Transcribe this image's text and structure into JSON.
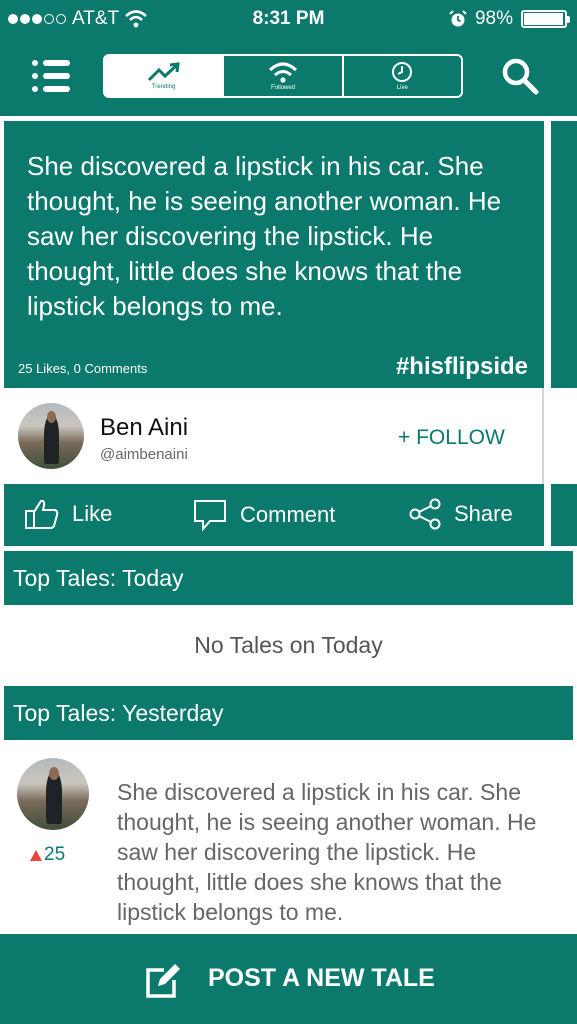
{
  "status_bar": {
    "carrier": "AT&T",
    "time": "8:31 PM",
    "battery": "98%",
    "battery_level": 0.98
  },
  "nav": {
    "tabs": [
      {
        "label": "Trending",
        "icon": "trending-up-icon",
        "active": true
      },
      {
        "label": "Followed",
        "icon": "wifi-icon",
        "active": false
      },
      {
        "label": "Live",
        "icon": "clock-icon",
        "active": false
      }
    ]
  },
  "featured_tale": {
    "text": "She discovered a lipstick in his car. She thought, he is seeing another woman. He saw her discovering the lipstick. He thought, little does she knows that the lipstick belongs to me.",
    "stats": "25 Likes, 0 Comments",
    "hashtag": "#hisflipside",
    "author_name": "Ben Aini",
    "author_handle": "@aimbenaini",
    "follow_label": "+ FOLLOW",
    "actions": {
      "like": "Like",
      "comment": "Comment",
      "share": "Share"
    }
  },
  "sections": {
    "today_title": "Top Tales: Today",
    "today_empty": "No Tales on Today",
    "yesterday_title": "Top Tales: Yesterday"
  },
  "yesterday_tale": {
    "votes": "25",
    "text": "She discovered a lipstick in his car. She thought, he is seeing another woman. He saw her discovering the lipstick. He thought, little does she knows that the lipstick belongs to me."
  },
  "post_button": {
    "label": "POST A NEW TALE"
  },
  "colors": {
    "brand": "#0b7a6c",
    "vote_up": "#e8473b"
  }
}
